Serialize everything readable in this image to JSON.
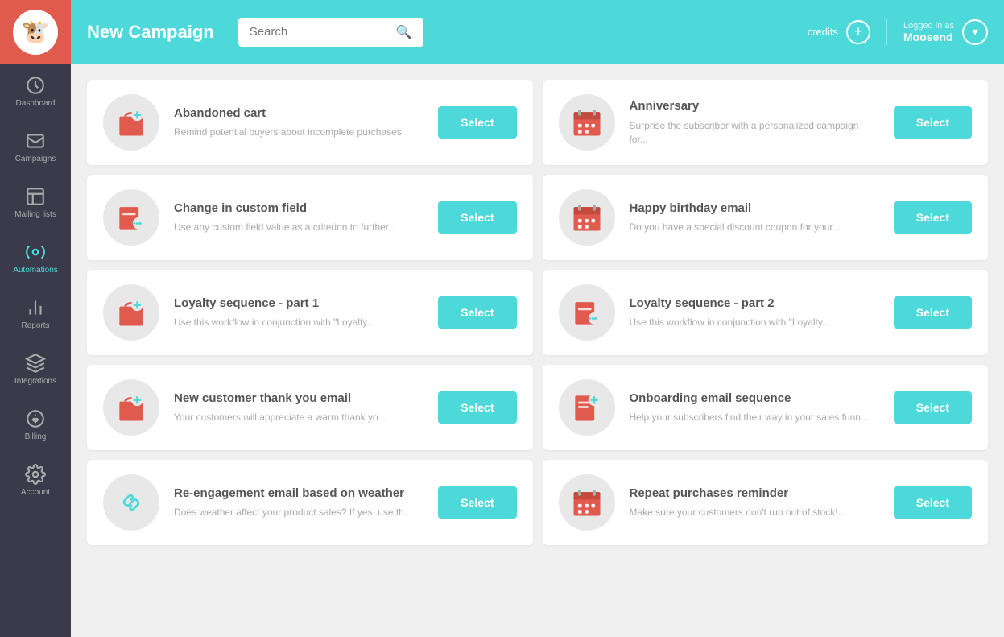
{
  "app": {
    "logo_emoji": "🐮"
  },
  "header": {
    "title": "New Campaign",
    "search_placeholder": "Search",
    "credits_label": "credits",
    "logged_in_as": "Logged in as",
    "username": "Moosend",
    "plus_icon": "+",
    "dropdown_icon": "▾"
  },
  "sidebar": {
    "items": [
      {
        "id": "dashboard",
        "label": "Dashboard",
        "active": false
      },
      {
        "id": "campaigns",
        "label": "Campaigns",
        "active": false
      },
      {
        "id": "mailing-lists",
        "label": "Mailing lists",
        "active": false
      },
      {
        "id": "automations",
        "label": "Automations",
        "active": true
      },
      {
        "id": "reports",
        "label": "Reports",
        "active": false
      },
      {
        "id": "integrations",
        "label": "Integrations",
        "active": false
      },
      {
        "id": "billing",
        "label": "Billing",
        "active": false
      },
      {
        "id": "account",
        "label": "Account",
        "active": false
      }
    ]
  },
  "cards": [
    {
      "id": "abandoned-cart",
      "title": "Abandoned cart",
      "desc": "Remind potential buyers about incomplete purchases.",
      "icon_type": "bag-plus",
      "btn_label": "Select"
    },
    {
      "id": "anniversary",
      "title": "Anniversary",
      "desc": "Surprise the subscriber with a personalized campaign for...",
      "icon_type": "calendar",
      "btn_label": "Select"
    },
    {
      "id": "change-custom-field",
      "title": "Change in custom field",
      "desc": "Use any custom field value as a criterion to further...",
      "icon_type": "custom-field",
      "btn_label": "Select"
    },
    {
      "id": "happy-birthday",
      "title": "Happy birthday email",
      "desc": "Do you have a special discount coupon for your...",
      "icon_type": "calendar",
      "btn_label": "Select"
    },
    {
      "id": "loyalty-1",
      "title": "Loyalty sequence - part 1",
      "desc": "Use this workflow in conjunction with \"Loyalty...",
      "icon_type": "bag-plus",
      "btn_label": "Select"
    },
    {
      "id": "loyalty-2",
      "title": "Loyalty sequence - part 2",
      "desc": "Use this workflow in conjunction with \"Loyalty...",
      "icon_type": "custom-field",
      "btn_label": "Select"
    },
    {
      "id": "new-customer-thank-you",
      "title": "New customer thank you email",
      "desc": "Your customers will appreciate a warm thank yo...",
      "icon_type": "bag-plus",
      "btn_label": "Select"
    },
    {
      "id": "onboarding",
      "title": "Onboarding email sequence",
      "desc": "Help your subscribers find their way in your sales funn...",
      "icon_type": "doc-plus",
      "btn_label": "Select"
    },
    {
      "id": "reengagement",
      "title": "Re-engagement email based on weather",
      "desc": "Does weather affect your product sales? If yes, use th...",
      "icon_type": "link",
      "btn_label": "Select"
    },
    {
      "id": "repeat-purchases",
      "title": "Repeat purchases reminder",
      "desc": "Make sure your customers don't run out of stock!...",
      "icon_type": "calendar",
      "btn_label": "Select"
    }
  ]
}
